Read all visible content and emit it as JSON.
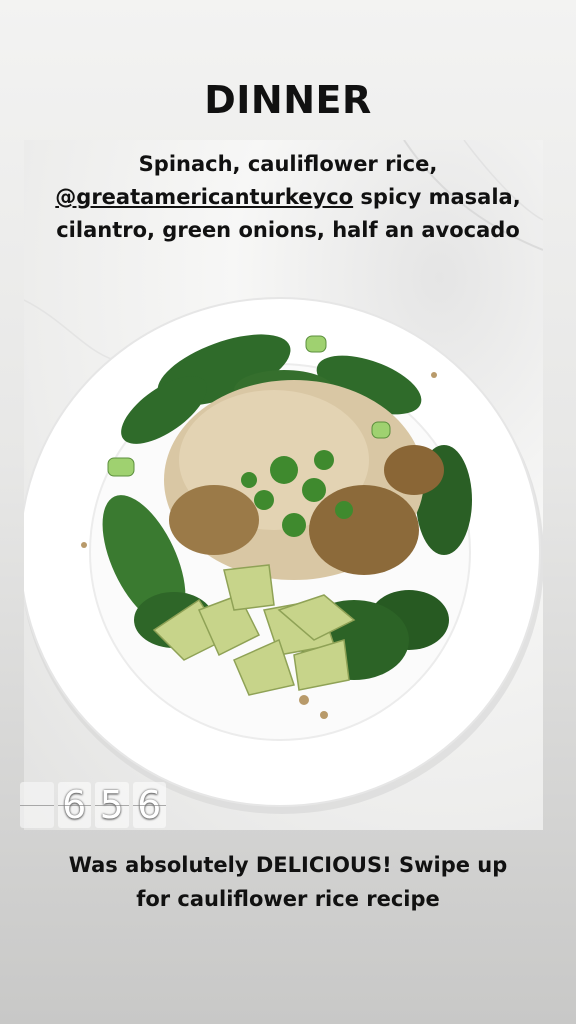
{
  "story": {
    "title": "DINNER",
    "caption": {
      "line1": "Spinach, cauliflower rice,",
      "mention": "@greatamericanturkeyco",
      "line2_rest": " spicy masala,",
      "line3": "cilantro, green onions, half an avocado"
    },
    "footer": {
      "line1": "Was absolutely DELICIOUS! Swipe up",
      "line2": "for cauliflower rice recipe"
    },
    "clock_sticker": {
      "digits": [
        "",
        "6",
        "5",
        "6"
      ]
    }
  },
  "colors": {
    "plate": "#ffffff",
    "spinach": "#2f6b2a",
    "rice": "#d9c7a4",
    "avocado": "#c7d48a",
    "text": "#111111"
  }
}
